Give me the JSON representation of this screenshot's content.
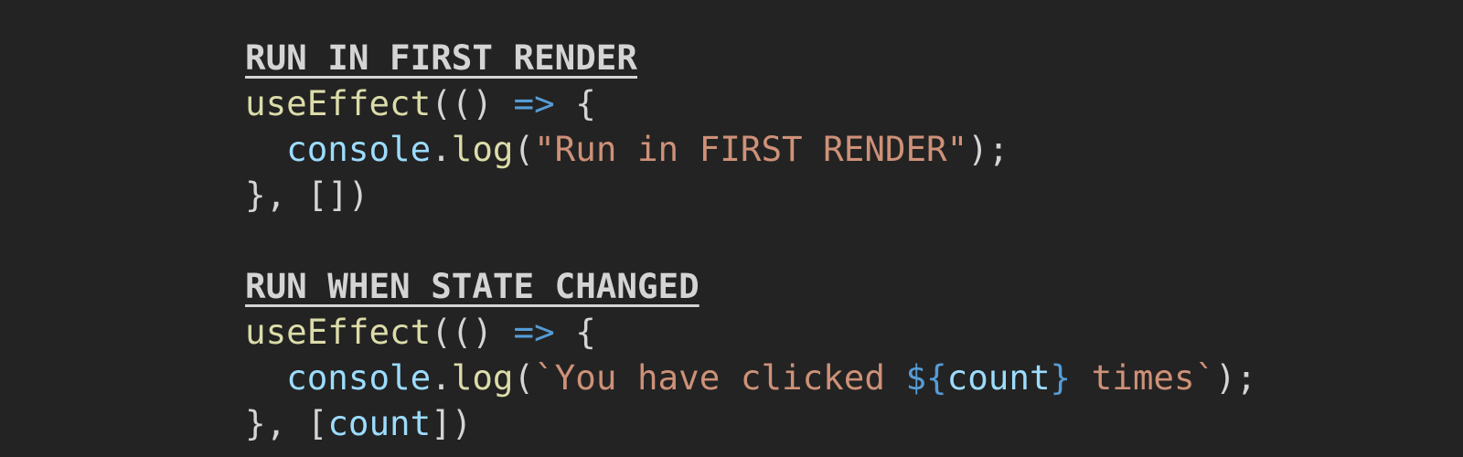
{
  "blocks": [
    {
      "heading": "RUN IN FIRST RENDER",
      "line1": {
        "fn": "useEffect",
        "open": "(() ",
        "arrow": "=>",
        "brace": " {"
      },
      "line2": {
        "indent": "  ",
        "obj": "console",
        "dot": ".",
        "method": "log",
        "open": "(",
        "string": "\"Run in FIRST RENDER\"",
        "close": ");"
      },
      "line3": {
        "close": "}, [",
        "deps": "",
        "end": "])"
      }
    },
    {
      "heading": "RUN WHEN STATE CHANGED",
      "line1": {
        "fn": "useEffect",
        "open": "(() ",
        "arrow": "=>",
        "brace": " {"
      },
      "line2": {
        "indent": "  ",
        "obj": "console",
        "dot": ".",
        "method": "log",
        "open": "(",
        "string_a": "`You have clicked ",
        "interp_open": "${",
        "interp_var": "count",
        "interp_close": "}",
        "string_b": " times`",
        "close": ");"
      },
      "line3": {
        "close": "}, [",
        "deps": "count",
        "end": "])"
      }
    }
  ],
  "colors": {
    "background": "#232323",
    "text": "#d4d4d4",
    "function": "#dcdcaa",
    "keyword": "#569cd6",
    "variable": "#9cdcfe",
    "string": "#ce9178"
  }
}
